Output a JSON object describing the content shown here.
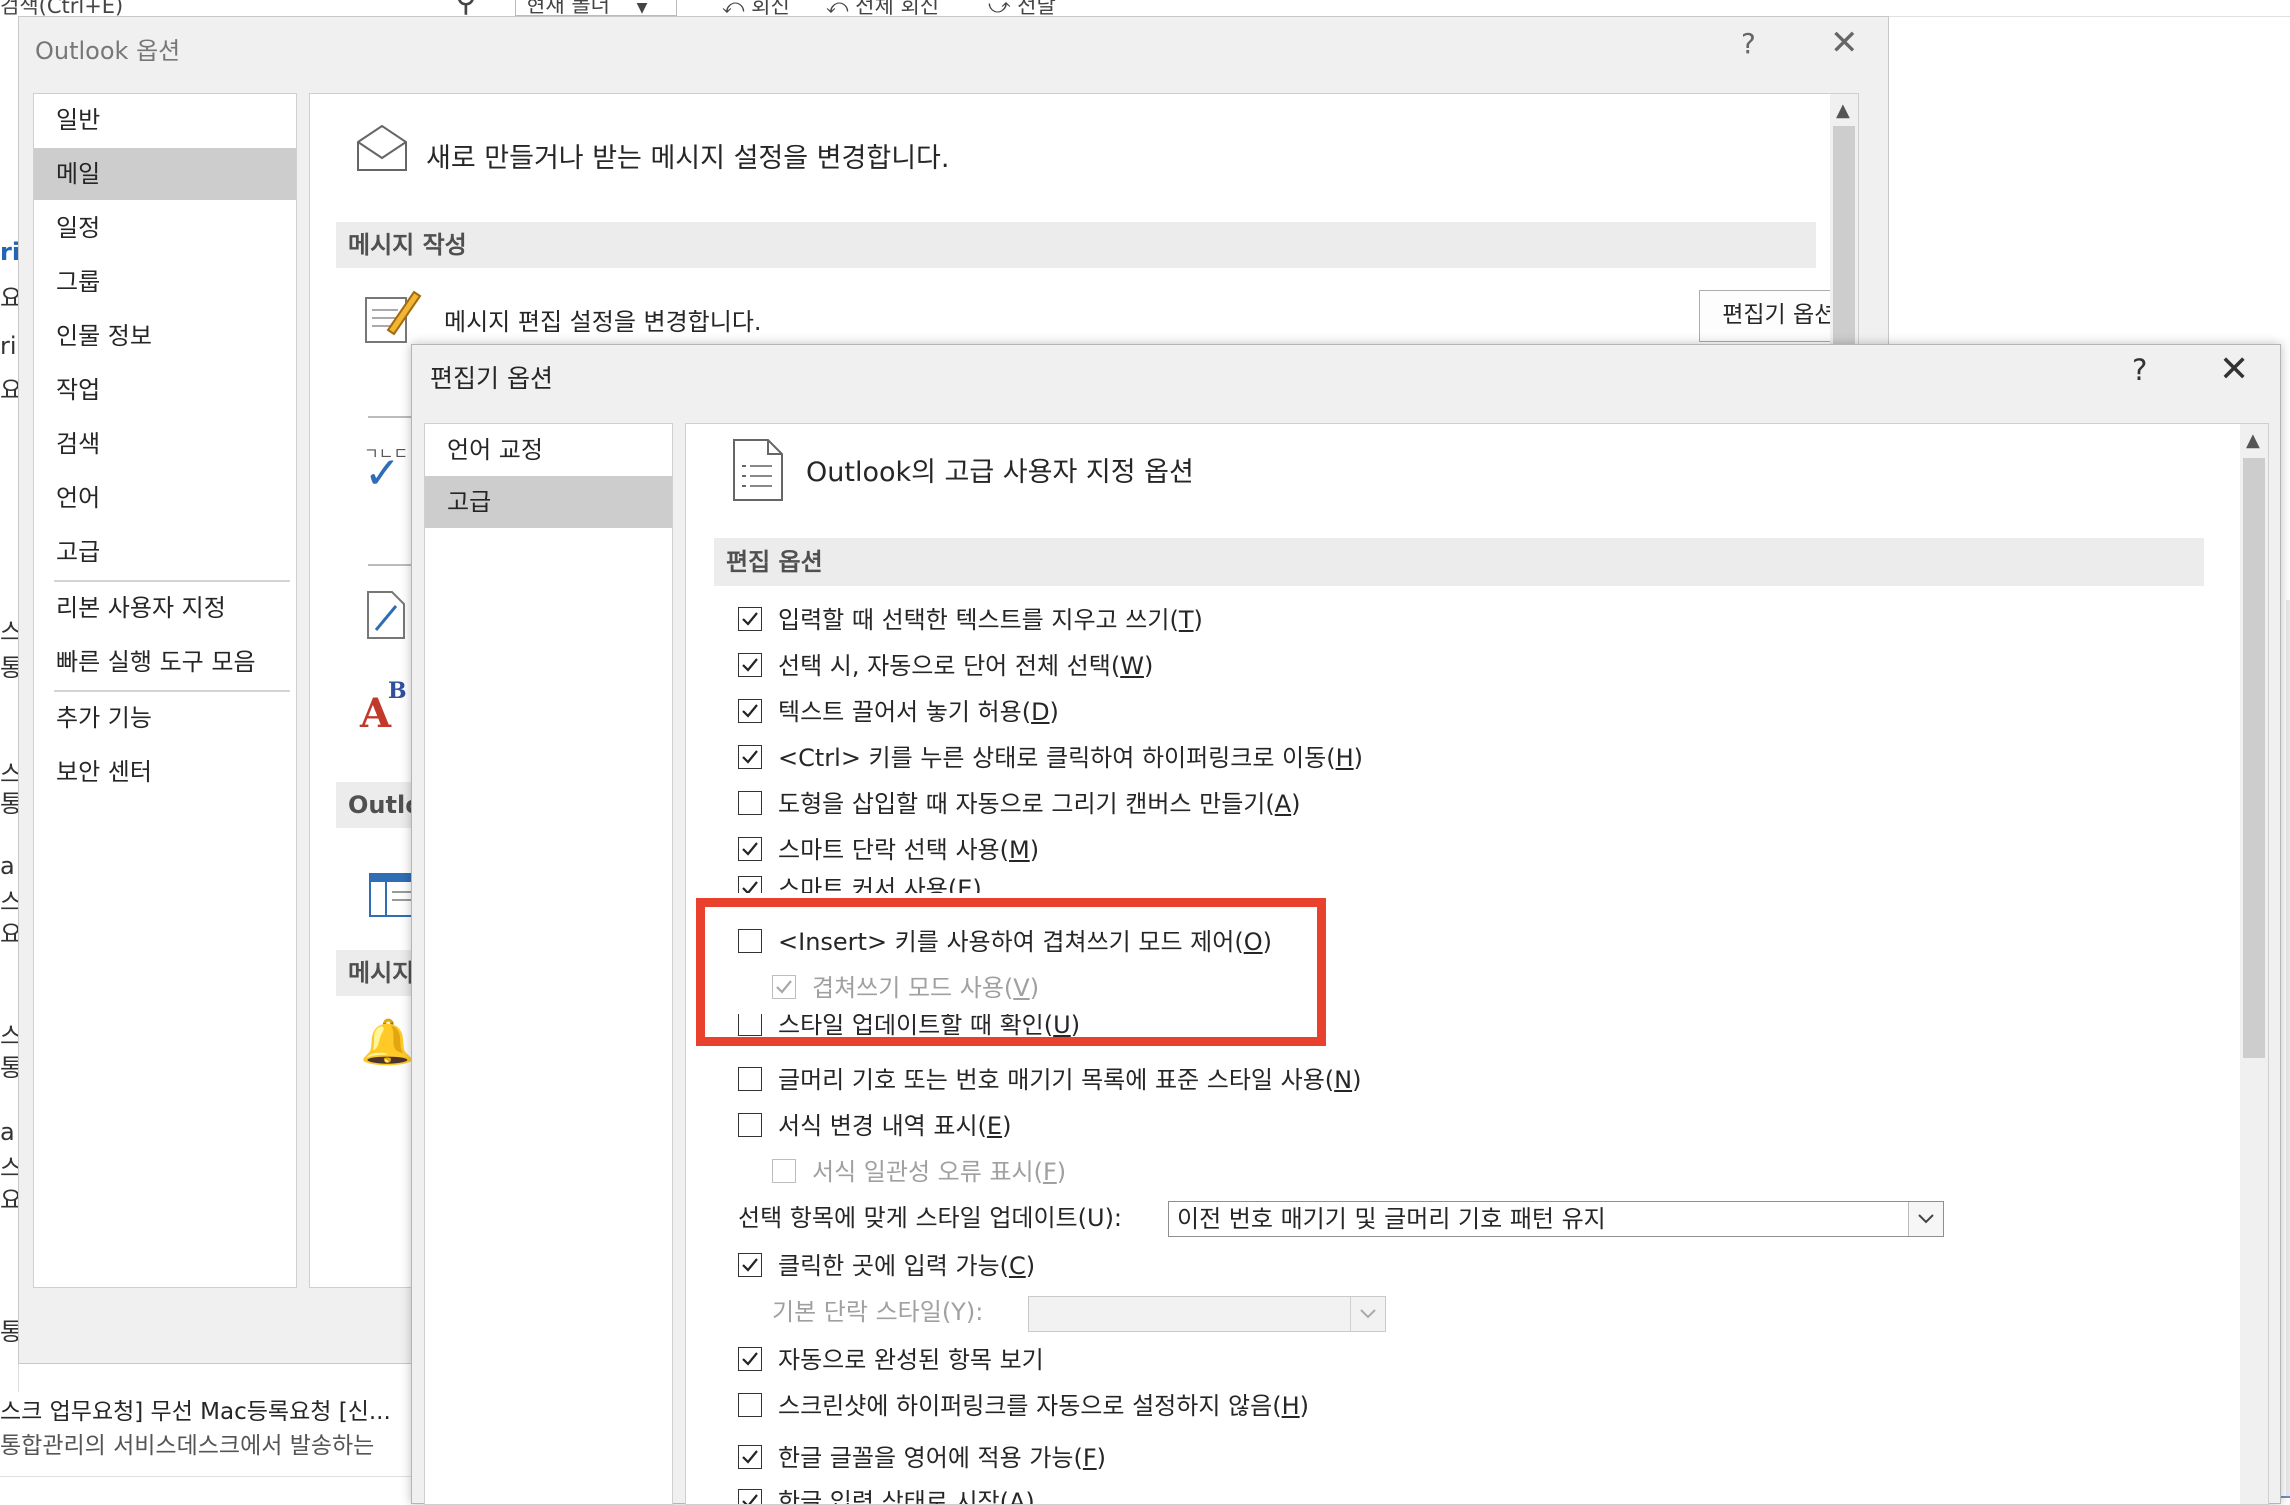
{
  "background": {
    "top_strip": {
      "search_hint": "검색(Ctrl+E)",
      "folder_select": "현재 폴더",
      "reply": "회신",
      "reply_all": "전체 회신",
      "forward": "전달"
    },
    "left_fragments": [
      "ri",
      "요",
      "ria",
      "요",
      "스",
      "통",
      "스",
      "통",
      "a",
      "스",
      "요",
      "스",
      "통",
      "a",
      "스",
      "요",
      "통"
    ],
    "bottom_list": {
      "line1": "스크 업무요청] 무선 Mac등록요청 [신...",
      "line2": "통합관리의 서비스데스크에서 발송하는"
    }
  },
  "outlook_options": {
    "title": "Outlook 옵션",
    "help": "?",
    "close": "✕",
    "nav": [
      "일반",
      "메일",
      "일정",
      "그룹",
      "인물 정보",
      "작업",
      "검색",
      "언어",
      "고급",
      "리본 사용자 지정",
      "빠른 실행 도구 모음",
      "추가 기능",
      "보안 센터"
    ],
    "selected_nav": "메일",
    "header": "새로 만들거나 받는 메시지 설정을 변경합니다.",
    "section_compose": "메시지 작성",
    "edit_settings_text": "메시지 편집 설정을 변경합니다.",
    "editor_options_button": "편집기 옵션(E)...",
    "truncated_section1": "Outlo",
    "truncated_section2": "메시지"
  },
  "editor_options": {
    "title": "편집기 옵션",
    "help": "?",
    "close": "✕",
    "nav": [
      "언어 교정",
      "고급"
    ],
    "selected_nav": "고급",
    "header": "Outlook의 고급 사용자 지정 옵션",
    "section": "편집 옵션",
    "options": [
      {
        "label": "입력할 때 선택한 텍스트를 지우고 쓰기",
        "key": "T",
        "checked": true,
        "disabled": false
      },
      {
        "label": "선택 시, 자동으로 단어 전체 선택",
        "key": "W",
        "checked": true,
        "disabled": false
      },
      {
        "label": "텍스트 끌어서 놓기 허용",
        "key": "D",
        "checked": true,
        "disabled": false
      },
      {
        "label": "<Ctrl> 키를 누른 상태로 클릭하여 하이퍼링크로 이동",
        "key": "H",
        "checked": true,
        "disabled": false
      },
      {
        "label": "도형을 삽입할 때 자동으로 그리기 캔버스 만들기",
        "key": "A",
        "checked": false,
        "disabled": false
      },
      {
        "label": "스마트 단락 선택 사용",
        "key": "M",
        "checked": true,
        "disabled": false
      },
      {
        "label": "스마트 커서 사용",
        "key": "E",
        "checked": true,
        "disabled": false
      },
      {
        "label": "<Insert> 키를 사용하여 겹쳐쓰기 모드 제어",
        "key": "O",
        "checked": false,
        "disabled": false
      },
      {
        "label": "겹쳐쓰기 모드 사용",
        "key": "V",
        "checked": true,
        "disabled": true
      },
      {
        "label": "스타일 업데이트할 때 확인",
        "key": "U",
        "checked": false,
        "disabled": false
      },
      {
        "label": "글머리 기호 또는 번호 매기기 목록에 표준 스타일 사용",
        "key": "N",
        "checked": false,
        "disabled": false
      },
      {
        "label": "서식 변경 내역 표시",
        "key": "E",
        "checked": false,
        "disabled": false
      },
      {
        "label": "서식 일관성 오류 표시",
        "key": "F",
        "checked": false,
        "disabled": true
      }
    ],
    "style_update_label": "선택 항목에 맞게 스타일 업데이트(U):",
    "style_update_value": "이전 번호 매기기 및 글머리 기호 패턴 유지",
    "options2": [
      {
        "label": "클릭한 곳에 입력 가능",
        "key": "C",
        "checked": true,
        "disabled": false
      }
    ],
    "base_style_label": "기본 단락 스타일(Y):",
    "options3": [
      {
        "label": "자동으로 완성된 항목 보기",
        "key": "",
        "checked": true,
        "disabled": false
      },
      {
        "label": "스크린샷에 하이퍼링크를 자동으로 설정하지 않음",
        "key": "H",
        "checked": false,
        "disabled": false
      },
      {
        "label": "한글 글꼴을 영어에 적용 가능",
        "key": "F",
        "checked": true,
        "disabled": false
      },
      {
        "label": "한글 입력 상태로 시작",
        "key": "A",
        "checked": true,
        "disabled": false
      }
    ]
  },
  "colors": {
    "highlight": "#e8412d",
    "nav_selected": "#cdcdcd",
    "section_bg": "#ececec"
  }
}
